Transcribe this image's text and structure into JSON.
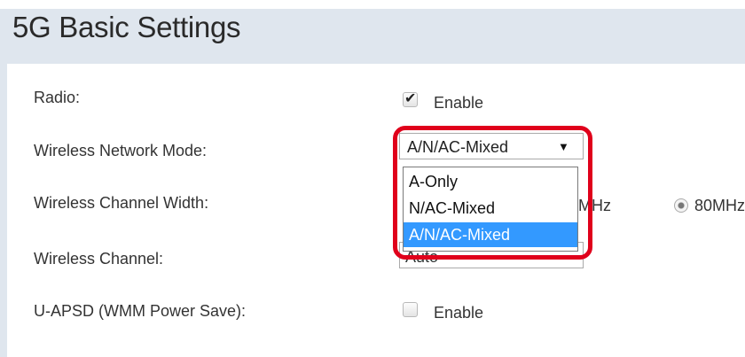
{
  "panel": {
    "title": "5G Basic Settings"
  },
  "rows": {
    "radio": {
      "label": "Radio:",
      "value": "Enable",
      "checked": true
    },
    "mode": {
      "label": "Wireless Network Mode:",
      "selected": "A/N/AC-Mixed"
    },
    "width": {
      "label": "Wireless Channel Width:",
      "option_partial": "MHz",
      "option_80": "80MHz"
    },
    "channel": {
      "label": "Wireless Channel:",
      "value": "Auto"
    },
    "uapsd": {
      "label": "U-APSD (WMM Power Save):",
      "value": "Enable",
      "checked": false
    }
  },
  "dropdown": {
    "options": [
      "A-Only",
      "N/AC-Mixed",
      "A/N/AC-Mixed"
    ],
    "highlighted": "A/N/AC-Mixed"
  },
  "icons": {
    "select_arrow": "▼",
    "checkbox_tick": "✔"
  },
  "colors": {
    "header_bg": "#dfe6ee",
    "highlight": "#e0001b",
    "selection": "#3399ff"
  }
}
